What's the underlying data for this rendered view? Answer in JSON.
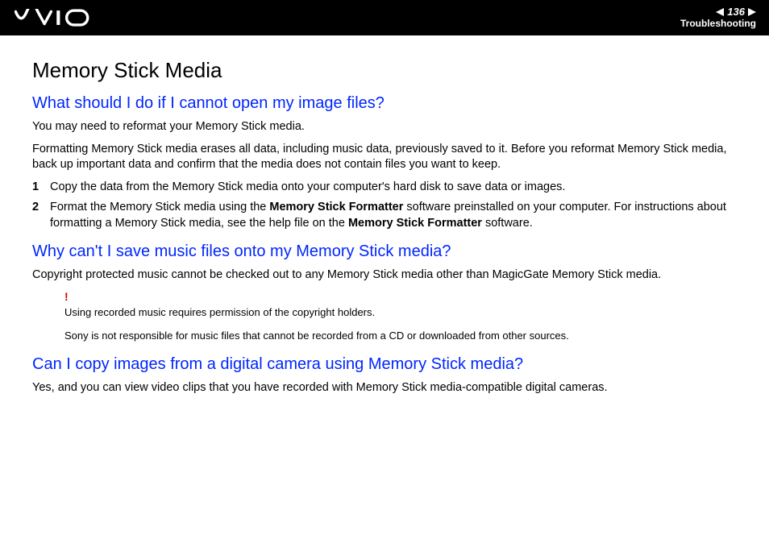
{
  "header": {
    "page_number": "136",
    "section": "Troubleshooting"
  },
  "title": "Memory Stick Media",
  "q1": {
    "heading": "What should I do if I cannot open my image files?",
    "p1": "You may need to reformat your Memory Stick media.",
    "p2": "Formatting Memory Stick media erases all data, including music data, previously saved to it. Before you reformat Memory Stick media, back up important data and confirm that the media does not contain files you want to keep.",
    "step1_num": "1",
    "step1": "Copy the data from the Memory Stick media onto your computer's hard disk to save data or images.",
    "step2_num": "2",
    "step2_a": "Format the Memory Stick media using the ",
    "step2_b": "Memory Stick Formatter",
    "step2_c": " software preinstalled on your computer. For instructions about formatting a Memory Stick media, see the help file on the ",
    "step2_d": "Memory Stick Formatter",
    "step2_e": " software."
  },
  "q2": {
    "heading": "Why can't I save music files onto my Memory Stick media?",
    "p1": "Copyright protected music cannot be checked out to any Memory Stick media other than MagicGate Memory Stick media.",
    "warn_mark": "!",
    "warn1": "Using recorded music requires permission of the copyright holders.",
    "warn2": "Sony is not responsible for music files that cannot be recorded from a CD or downloaded from other sources."
  },
  "q3": {
    "heading": "Can I copy images from a digital camera using Memory Stick media?",
    "p1": "Yes, and you can view video clips that you have recorded with Memory Stick media-compatible digital cameras."
  }
}
